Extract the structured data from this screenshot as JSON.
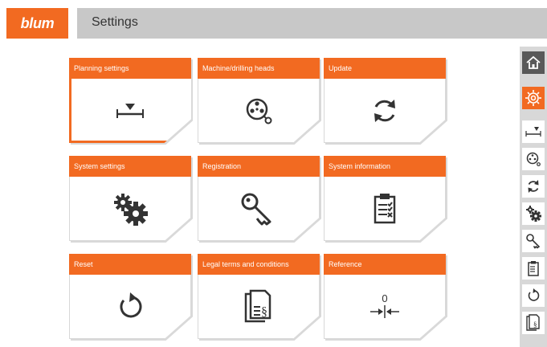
{
  "header": {
    "logo": "blum",
    "title": "Settings"
  },
  "tiles": [
    {
      "label": "Planning settings",
      "icon": "planning-icon"
    },
    {
      "label": "Machine/drilling heads",
      "icon": "drilling-head-icon"
    },
    {
      "label": "Update",
      "icon": "update-icon"
    },
    {
      "label": "System settings",
      "icon": "gears-icon"
    },
    {
      "label": "Registration",
      "icon": "key-icon"
    },
    {
      "label": "System information",
      "icon": "clipboard-icon"
    },
    {
      "label": "Reset",
      "icon": "reset-icon"
    },
    {
      "label": "Legal terms and conditions",
      "icon": "legal-document-icon"
    },
    {
      "label": "Reference",
      "icon": "reference-icon",
      "value": "0"
    }
  ],
  "sidebar": {
    "items": [
      "home-icon",
      "settings-icon",
      "planning-icon",
      "drilling-head-icon",
      "update-icon",
      "gears-icon",
      "key-icon",
      "clipboard-icon",
      "reset-icon",
      "legal-document-icon"
    ]
  },
  "colors": {
    "accent": "#f26a21",
    "titlebar": "#c8c8c8",
    "sidebar": "#d8d8d8",
    "home": "#595959"
  }
}
